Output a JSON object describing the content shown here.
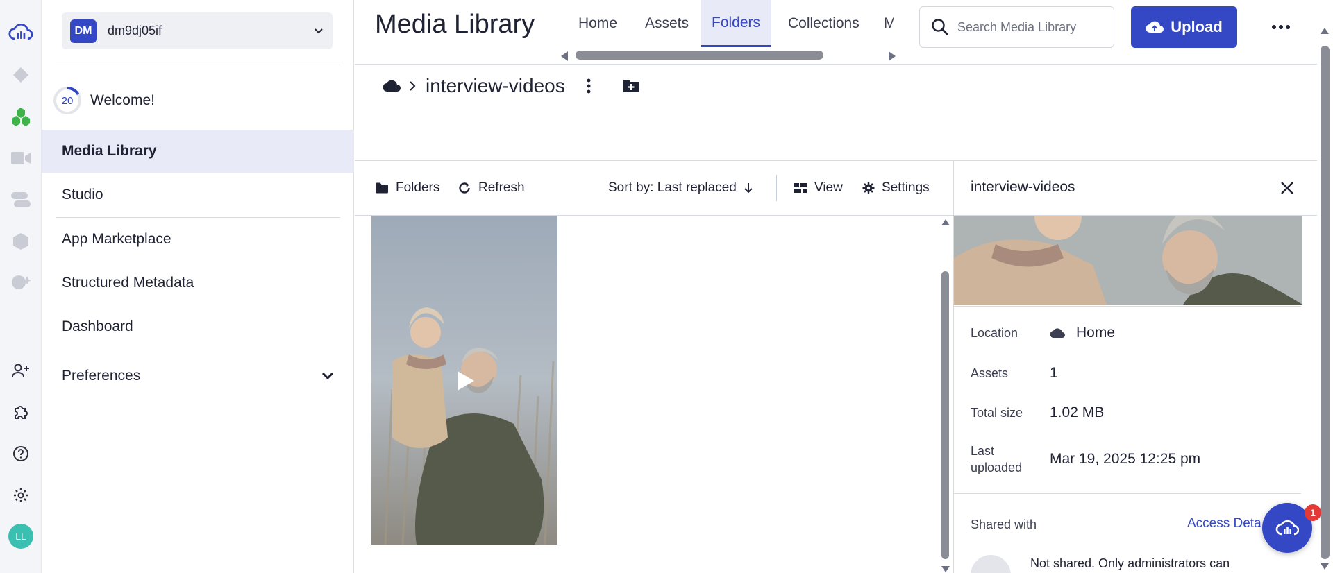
{
  "account": {
    "initials": "DM",
    "name": "dm9dj05if"
  },
  "welcome": {
    "progress_value": "20",
    "label": "Welcome!"
  },
  "sidebar": {
    "items": [
      {
        "label": "Media Library",
        "active": true
      },
      {
        "label": "Studio"
      },
      {
        "label": "App Marketplace"
      },
      {
        "label": "Structured Metadata"
      },
      {
        "label": "Dashboard"
      },
      {
        "label": "Preferences"
      }
    ]
  },
  "rail": {
    "user_initials": "LL"
  },
  "header": {
    "title": "Media Library",
    "tabs": [
      {
        "label": "Home"
      },
      {
        "label": "Assets"
      },
      {
        "label": "Folders",
        "active": true
      },
      {
        "label": "Collections"
      },
      {
        "label": "M"
      }
    ],
    "search_placeholder": "Search Media Library",
    "upload_label": "Upload"
  },
  "breadcrumb": {
    "current": "interview-videos"
  },
  "toolbar": {
    "folders_label": "Folders",
    "refresh_label": "Refresh",
    "sort_label": "Sort by: Last replaced",
    "view_label": "View",
    "settings_label": "Settings"
  },
  "details": {
    "title": "interview-videos",
    "location_key": "Location",
    "location_value": "Home",
    "assets_key": "Assets",
    "assets_value": "1",
    "total_size_key": "Total size",
    "total_size_value": "1.02 MB",
    "last_uploaded_key_line1": "Last",
    "last_uploaded_key_line2": "uploaded",
    "last_uploaded_value": "Mar 19, 2025 12:25 pm",
    "shared_with_key": "Shared with",
    "access_link": "Access Deta",
    "not_shared_text": "Not shared. Only administrators can"
  },
  "chat": {
    "badge_count": "1"
  },
  "colors": {
    "accent": "#3448c5",
    "active_bg": "#e8eaf7",
    "badge": "#e53935"
  }
}
